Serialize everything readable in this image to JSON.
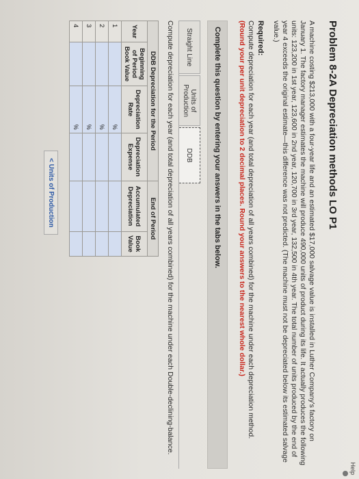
{
  "header": {
    "help_label": "Help"
  },
  "problem": {
    "title": "Problem 8-2A Depreciation methods LO P1",
    "text": "A machine costing $213,000 with a four-year life and an estimated $17,000 salvage value is installed in Luther Company's factory on January 1. The factory manager estimates the machine will produce 490,000 units of product during its life. It actually produces the following units: 123,200 in 1st year, 123,600 in 2nd year, 120,700 in 3rd year, 132,500 in 4th year. The total number of units produced by the end of year 4 exceeds the original estimate—this difference was not predicted. (The machine must not be depreciated below its estimated salvage value.)"
  },
  "required": {
    "title": "Required:",
    "text": "Compute depreciation for each year (and total depreciation of all years combined) for the machine under each depreciation method.",
    "note": "(Round your per unit depreciation to 2 decimal places. Round your answers to the nearest whole dollar.)"
  },
  "instructions": "Complete this question by entering your answers in the tabs below.",
  "tabs": [
    {
      "label": "Straight Line"
    },
    {
      "label": "Units of Production"
    },
    {
      "label": "DDB"
    }
  ],
  "tab_instruction": "Compute depreciation for each year (and total depreciation of all years combined) for the machine under each Double-declining-balance.",
  "table": {
    "caption_left": "DDB Depreciation for the Period",
    "caption_right": "End of Period",
    "headers": [
      "Year",
      "Beginning of Period Book Value",
      "Depreciation Rate",
      "Depreciation Expense",
      "Accumulated Depreciation",
      "Book Value"
    ],
    "rows": [
      {
        "year": "1",
        "rate_unit": "%"
      },
      {
        "year": "2",
        "rate_unit": "%"
      },
      {
        "year": "3",
        "rate_unit": "%"
      },
      {
        "year": "4",
        "rate_unit": "%"
      }
    ]
  },
  "nav": {
    "back_label": "Units of Production",
    "back_arrow": "<"
  }
}
